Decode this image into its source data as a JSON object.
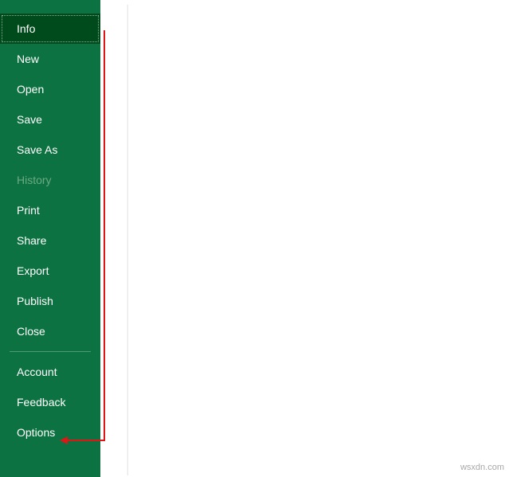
{
  "sidebar": {
    "items": [
      {
        "label": "Info",
        "selected": true,
        "disabled": false
      },
      {
        "label": "New",
        "selected": false,
        "disabled": false
      },
      {
        "label": "Open",
        "selected": false,
        "disabled": false
      },
      {
        "label": "Save",
        "selected": false,
        "disabled": false
      },
      {
        "label": "Save As",
        "selected": false,
        "disabled": false
      },
      {
        "label": "History",
        "selected": false,
        "disabled": true
      },
      {
        "label": "Print",
        "selected": false,
        "disabled": false
      },
      {
        "label": "Share",
        "selected": false,
        "disabled": false
      },
      {
        "label": "Export",
        "selected": false,
        "disabled": false
      },
      {
        "label": "Publish",
        "selected": false,
        "disabled": false
      },
      {
        "label": "Close",
        "selected": false,
        "disabled": false
      }
    ],
    "bottom_items": [
      {
        "label": "Account",
        "selected": false,
        "disabled": false
      },
      {
        "label": "Feedback",
        "selected": false,
        "disabled": false
      },
      {
        "label": "Options",
        "selected": false,
        "disabled": false
      }
    ]
  },
  "watermark": "wsxdn.com",
  "colors": {
    "sidebar_bg": "#0d7241",
    "selected_bg": "#004b1c",
    "annotation": "#e01515"
  }
}
